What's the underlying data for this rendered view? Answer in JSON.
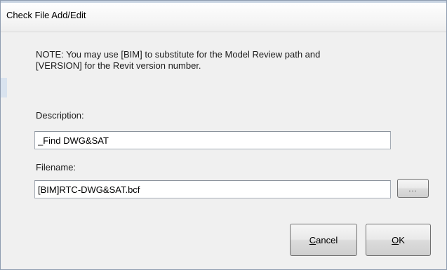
{
  "window": {
    "title": "Check File Add/Edit"
  },
  "note": {
    "line1": "NOTE: You may use [BIM] to substitute for the Model Review path and",
    "line2": "[VERSION] for the Revit version number."
  },
  "description": {
    "label": "Description:",
    "value": "_Find DWG&SAT"
  },
  "filename": {
    "label": "Filename:",
    "value": "[BIM]RTC-DWG&SAT.bcf",
    "browse_label": "..."
  },
  "buttons": {
    "cancel": {
      "mnemonic": "C",
      "rest": "ancel"
    },
    "ok": {
      "mnemonic": "O",
      "rest": "K"
    }
  }
}
